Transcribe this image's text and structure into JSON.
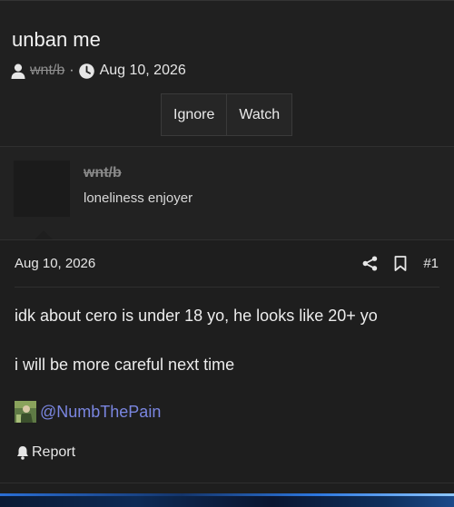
{
  "thread": {
    "title": "unban me",
    "author": "wnt/b",
    "separator": "·",
    "date": "Aug 10, 2026",
    "buttons": {
      "ignore": "Ignore",
      "watch": "Watch"
    }
  },
  "post": {
    "username": "wnt/b",
    "user_title": "loneliness enjoyer",
    "date": "Aug 10, 2026",
    "number": "#1",
    "lines": [
      "idk about cero is under 18 yo, he looks like 20+ yo",
      "i will be more careful next time"
    ],
    "mention": "@NumbThePain",
    "report_label": "Report"
  },
  "icons": {
    "author": "user-icon",
    "date": "clock-icon",
    "share": "share-icon",
    "bookmark": "bookmark-icon",
    "report": "bell-icon"
  },
  "colors": {
    "background": "#1e1e1e",
    "mention_link": "#7a86e0",
    "struck_username": "#8a8a8a"
  }
}
